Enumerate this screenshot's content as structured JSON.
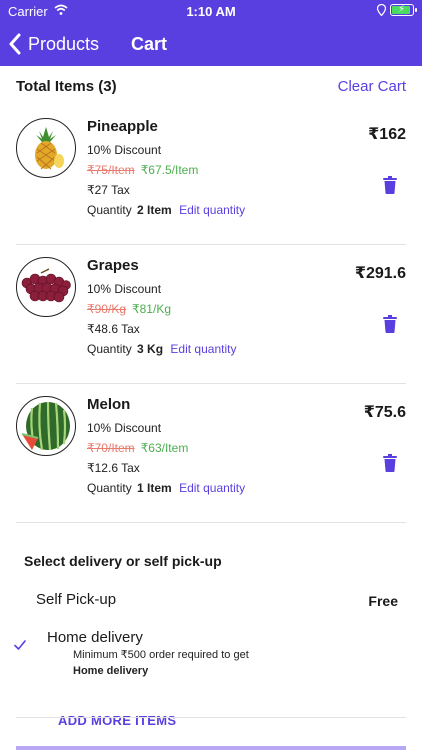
{
  "status": {
    "carrier": "Carrier",
    "time": "1:10 AM"
  },
  "nav": {
    "back_label": "Products",
    "title": "Cart"
  },
  "cart": {
    "total_label": "Total Items (3)",
    "clear_label": "Clear Cart"
  },
  "items": [
    {
      "name": "Pineapple",
      "discount": "10% Discount",
      "old_price": "₹75/Item",
      "new_price": "₹67.5/Item",
      "tax": "₹27 Tax",
      "quantity_label": "Quantity",
      "quantity": "2 Item",
      "edit_label": "Edit quantity",
      "total": "₹162",
      "image": "pineapple-image"
    },
    {
      "name": "Grapes",
      "discount": "10% Discount",
      "old_price": "₹90/Kg",
      "new_price": "₹81/Kg",
      "tax": "₹48.6 Tax",
      "quantity_label": "Quantity",
      "quantity": "3 Kg",
      "edit_label": "Edit quantity",
      "total": "₹291.6",
      "image": "grapes-image"
    },
    {
      "name": "Melon",
      "discount": "10% Discount",
      "old_price": "₹70/Item",
      "new_price": "₹63/Item",
      "tax": "₹12.6 Tax",
      "quantity_label": "Quantity",
      "quantity": "1 Item",
      "edit_label": "Edit quantity",
      "total": "₹75.6",
      "image": "melon-image"
    }
  ],
  "delivery": {
    "title": "Select delivery or self pick-up",
    "self_pickup_label": "Self Pick-up",
    "self_pickup_price": "Free",
    "home_label": "Home delivery",
    "home_note": "Minimum ₹500 order required to get",
    "home_note_bold": "Home delivery",
    "selected": "home"
  },
  "add_more_label": "ADD MORE ITEMS",
  "colors": {
    "accent": "#5a3fe0",
    "discount_old": "#e87a6e",
    "discount_new": "#4caf50"
  }
}
